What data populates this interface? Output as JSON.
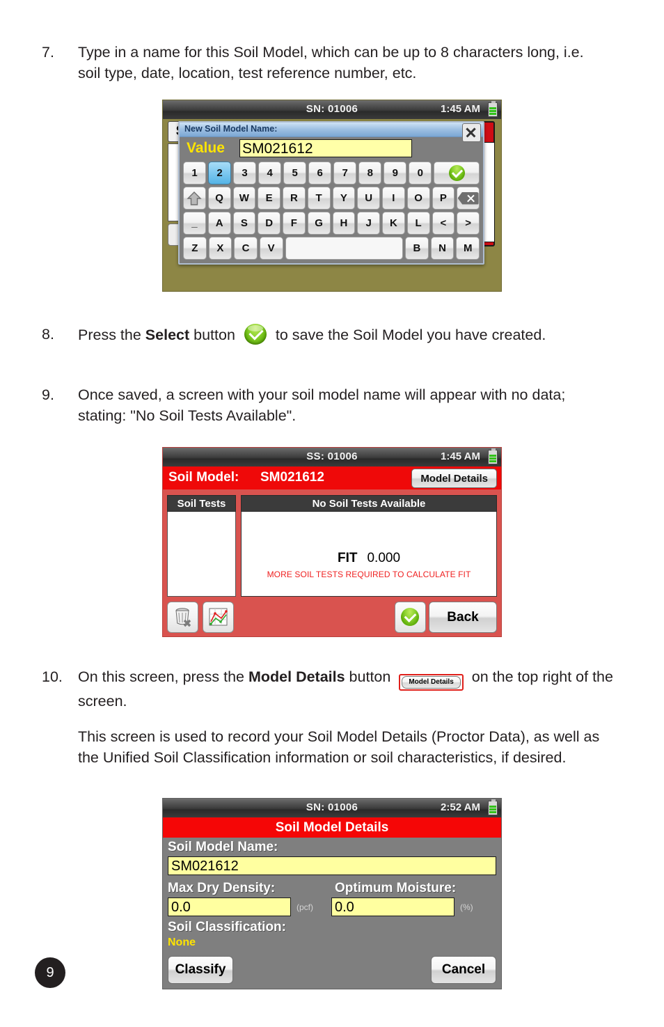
{
  "page": {
    "number": "9"
  },
  "steps": [
    {
      "num": "7.",
      "text_before": "Type in a name for this Soil Model, which can be up to 8 characters long, i.e. soil type, date, location, test reference number, etc."
    },
    {
      "num": "8.",
      "seg1": "Press the ",
      "bold1": "Select",
      "seg2": " button ",
      "seg3": " to save the Soil Model you have created."
    },
    {
      "num": "9.",
      "text": "Once saved, a screen with your soil model name will appear with no data; stating: \"No Soil Tests Available\"."
    },
    {
      "num": "10.",
      "seg1": "On this screen, press the ",
      "bold1": "Model Details",
      "seg2": " button ",
      "inline_button": "Model Details",
      "seg3": " on the top right of the screen.",
      "paragraph": "This screen is used to record your Soil Model Details (Proctor Data), as well as the Unified Soil Classification information or soil characteristics, if desired."
    }
  ],
  "shot1": {
    "status": {
      "sn": "SN: 01006",
      "time": "1:45 AM",
      "battery_icon": "battery-icon"
    },
    "background": {
      "letter_s": "S"
    },
    "dialog": {
      "title": "New Soil Model Name:",
      "close_icon": "close-icon",
      "value_label": "Value",
      "value_text": "SM021612"
    },
    "keyboard": {
      "row1": [
        "1",
        "2",
        "3",
        "4",
        "5",
        "6",
        "7",
        "8",
        "9",
        "0"
      ],
      "row1_selected": "2",
      "row1_action": "ok-check-icon",
      "row2_shift": "shift-icon",
      "row2": [
        "Q",
        "W",
        "E",
        "R",
        "T",
        "Y",
        "U",
        "I",
        "O",
        "P"
      ],
      "row2_action": "backspace-icon",
      "row3_underscore": "_",
      "row3": [
        "A",
        "S",
        "D",
        "F",
        "G",
        "H",
        "J",
        "K",
        "L",
        "<",
        ">"
      ],
      "row4_left": [
        "Z",
        "X",
        "C",
        "V"
      ],
      "row4_space": "",
      "row4_right": [
        "B",
        "N",
        "M"
      ]
    }
  },
  "shot2": {
    "status": {
      "sn": "SS: 01006",
      "time": "1:45 AM",
      "battery_icon": "battery-icon"
    },
    "header": {
      "label": "Soil Model:",
      "value": "SM021612",
      "model_details_button": "Model Details"
    },
    "left_panel": {
      "header": "Soil Tests"
    },
    "right_panel": {
      "header": "No Soil Tests Available",
      "fit_label": "FIT",
      "fit_value": "0.000",
      "note": "MORE SOIL TESTS REQUIRED TO CALCULATE FIT"
    },
    "toolbar": {
      "delete_icon": "trash-delete-icon",
      "chart_icon": "chart-graph-icon",
      "ok_icon": "ok-check-icon",
      "back_label": "Back"
    }
  },
  "shot3": {
    "status": {
      "sn": "SN: 01006",
      "time": "2:52 AM",
      "battery_icon": "battery-icon"
    },
    "title": "Soil Model Details",
    "fields": {
      "name_label": "Soil Model Name:",
      "name_value": "SM021612",
      "max_dry_density_label": "Max Dry Density:",
      "max_dry_density_value": "0.0",
      "max_dry_density_unit": "(pcf)",
      "optimum_moisture_label": "Optimum Moisture:",
      "optimum_moisture_value": "0.0",
      "optimum_moisture_unit": "(%)",
      "soil_classification_label": "Soil Classification:",
      "soil_classification_value": "None"
    },
    "buttons": {
      "classify": "Classify",
      "cancel": "Cancel"
    }
  },
  "colors": {
    "red_header": "#ef0909",
    "red_body": "#d9534f",
    "yellow_field": "#ffffa0",
    "green_ok": "#82cd27",
    "olive_bg": "#8d8645"
  }
}
